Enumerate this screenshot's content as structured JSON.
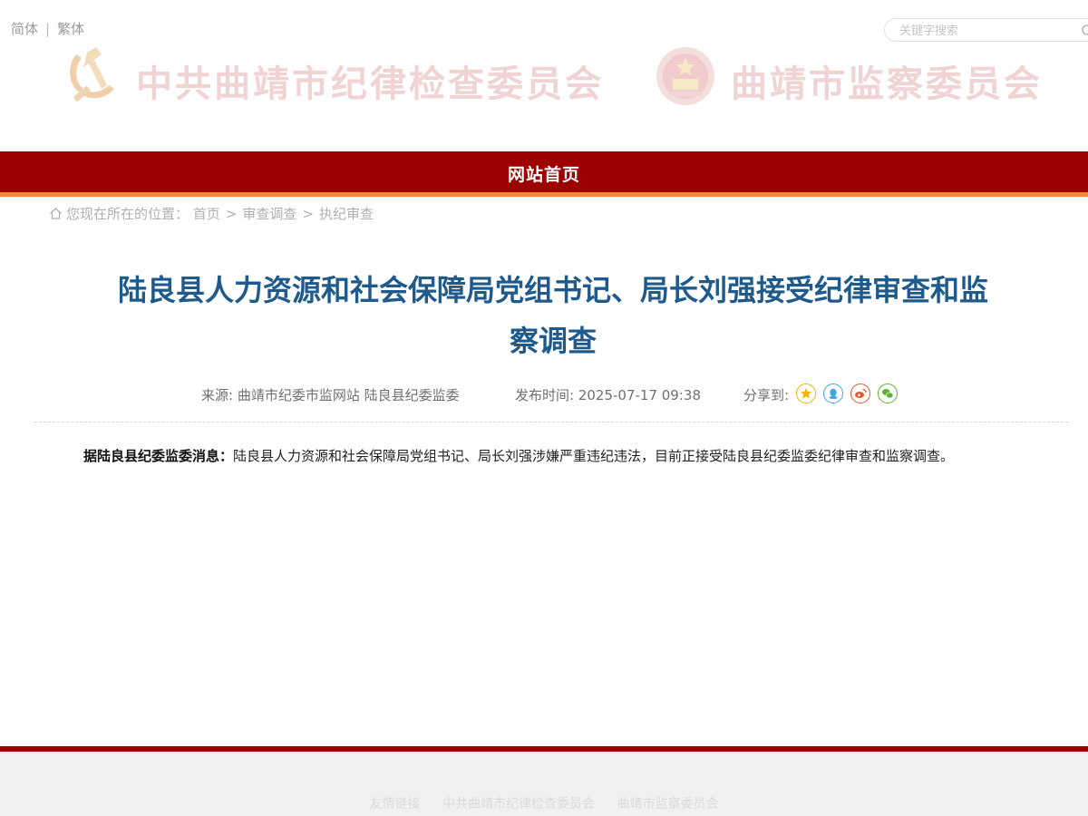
{
  "header": {
    "lang_simplified": "简体",
    "lang_separator": "|",
    "lang_traditional": "繁体",
    "search_placeholder": "关键字搜索",
    "title_commission": "中共曲靖市纪律检查委员会",
    "title_supervision": "曲靖市监察委员会"
  },
  "nav": {
    "home_label": "网站首页"
  },
  "breadcrumb": {
    "prefix": "您现在所在的位置：",
    "items": [
      "首页",
      "审查调查",
      "执纪审查"
    ],
    "separator": ">"
  },
  "article": {
    "title": "陆良县人力资源和社会保障局党组书记、局长刘强接受纪律审查和监察调查",
    "source": "来源: 曲靖市纪委市监网站 陆良县纪委监委",
    "publish_time": "发布时间: 2025-07-17 09:38",
    "share_label": "分享到:",
    "body_lead": "据陆良县纪委监委消息：",
    "body_text": "陆良县人力资源和社会保障局党组书记、局长刘强涉嫌严重违纪违法，目前正接受陆良县纪委监委纪律审查和监察调查。"
  },
  "share_icons": [
    {
      "name": "favorite-star-icon",
      "color": "#f5b400"
    },
    {
      "name": "qq-icon",
      "color": "#3ea6e2"
    },
    {
      "name": "weibo-icon",
      "color": "#e8562b"
    },
    {
      "name": "wechat-icon",
      "color": "#5bb52e"
    }
  ],
  "footer": {
    "links": [
      "友情链接",
      "中共曲靖市纪律检查委员会",
      "曲靖市监察委员会"
    ]
  },
  "colors": {
    "nav_red": "#9c0000",
    "nav_stripe": "#f08a3c",
    "title_blue": "#1f5a8c"
  }
}
